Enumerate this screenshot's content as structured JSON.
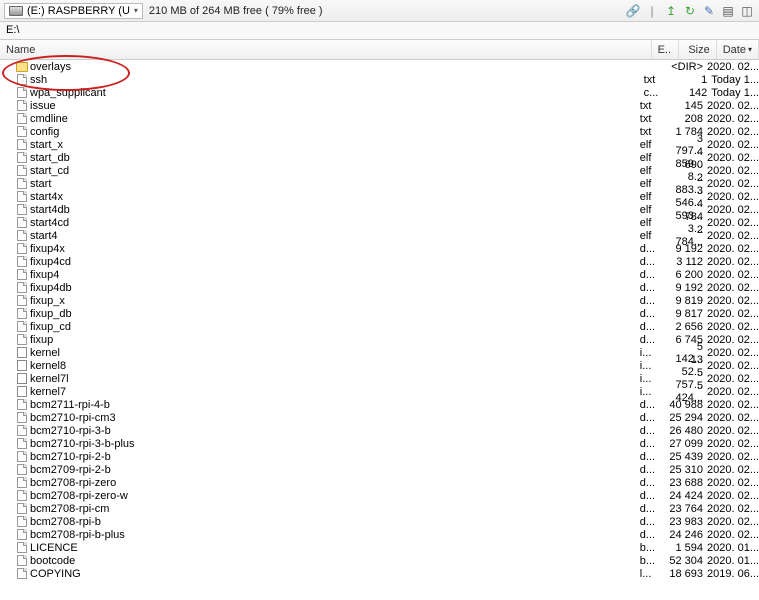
{
  "toolbar": {
    "drive_label": "(E:) RASPBERRY (U",
    "free_space": "210 MB of 264 MB free ( 79% free )"
  },
  "path": "E:\\",
  "headers": {
    "name": "Name",
    "ext": "E..",
    "size": "Size",
    "date": "Date"
  },
  "files": [
    {
      "icon": "folder",
      "name": "overlays",
      "ext": "",
      "size": "<DIR>",
      "date": "2020. 02..."
    },
    {
      "icon": "file",
      "name": "ssh",
      "ext": "txt",
      "size": "1",
      "date": "Today 1..."
    },
    {
      "icon": "file",
      "name": "wpa_supplicant",
      "ext": "c...",
      "size": "142",
      "date": "Today 1..."
    },
    {
      "icon": "file",
      "name": "issue",
      "ext": "txt",
      "size": "145",
      "date": "2020. 02..."
    },
    {
      "icon": "file",
      "name": "cmdline",
      "ext": "txt",
      "size": "208",
      "date": "2020. 02..."
    },
    {
      "icon": "file",
      "name": "config",
      "ext": "txt",
      "size": "1 784",
      "date": "2020. 02..."
    },
    {
      "icon": "file",
      "name": "start_x",
      "ext": "elf",
      "size": "3 797...",
      "date": "2020. 02..."
    },
    {
      "icon": "file",
      "name": "start_db",
      "ext": "elf",
      "size": "4 859...",
      "date": "2020. 02..."
    },
    {
      "icon": "file",
      "name": "start_cd",
      "ext": "elf",
      "size": "690 8...",
      "date": "2020. 02..."
    },
    {
      "icon": "file",
      "name": "start",
      "ext": "elf",
      "size": "2 883...",
      "date": "2020. 02..."
    },
    {
      "icon": "file",
      "name": "start4x",
      "ext": "elf",
      "size": "3 546...",
      "date": "2020. 02..."
    },
    {
      "icon": "file",
      "name": "start4db",
      "ext": "elf",
      "size": "4 593...",
      "date": "2020. 02..."
    },
    {
      "icon": "file",
      "name": "start4cd",
      "ext": "elf",
      "size": "784 3...",
      "date": "2020. 02..."
    },
    {
      "icon": "file",
      "name": "start4",
      "ext": "elf",
      "size": "2 784...",
      "date": "2020. 02..."
    },
    {
      "icon": "file",
      "name": "fixup4x",
      "ext": "d...",
      "size": "9 192",
      "date": "2020. 02..."
    },
    {
      "icon": "file",
      "name": "fixup4cd",
      "ext": "d...",
      "size": "3 112",
      "date": "2020. 02..."
    },
    {
      "icon": "file",
      "name": "fixup4",
      "ext": "d...",
      "size": "6 200",
      "date": "2020. 02..."
    },
    {
      "icon": "file",
      "name": "fixup4db",
      "ext": "d...",
      "size": "9 192",
      "date": "2020. 02..."
    },
    {
      "icon": "file",
      "name": "fixup_x",
      "ext": "d...",
      "size": "9 819",
      "date": "2020. 02..."
    },
    {
      "icon": "file",
      "name": "fixup_db",
      "ext": "d...",
      "size": "9 817",
      "date": "2020. 02..."
    },
    {
      "icon": "file",
      "name": "fixup_cd",
      "ext": "d...",
      "size": "2 656",
      "date": "2020. 02..."
    },
    {
      "icon": "file",
      "name": "fixup",
      "ext": "d...",
      "size": "6 745",
      "date": "2020. 02..."
    },
    {
      "icon": "bin",
      "name": "kernel",
      "ext": "i...",
      "size": "5 142...",
      "date": "2020. 02..."
    },
    {
      "icon": "bin",
      "name": "kernel8",
      "ext": "i...",
      "size": "13 52...",
      "date": "2020. 02..."
    },
    {
      "icon": "bin",
      "name": "kernel7l",
      "ext": "i...",
      "size": "5 757...",
      "date": "2020. 02..."
    },
    {
      "icon": "bin",
      "name": "kernel7",
      "ext": "i...",
      "size": "5 424...",
      "date": "2020. 02..."
    },
    {
      "icon": "file",
      "name": "bcm2711-rpi-4-b",
      "ext": "d...",
      "size": "40 988",
      "date": "2020. 02..."
    },
    {
      "icon": "file",
      "name": "bcm2710-rpi-cm3",
      "ext": "d...",
      "size": "25 294",
      "date": "2020. 02..."
    },
    {
      "icon": "file",
      "name": "bcm2710-rpi-3-b",
      "ext": "d...",
      "size": "26 480",
      "date": "2020. 02..."
    },
    {
      "icon": "file",
      "name": "bcm2710-rpi-3-b-plus",
      "ext": "d...",
      "size": "27 099",
      "date": "2020. 02..."
    },
    {
      "icon": "file",
      "name": "bcm2710-rpi-2-b",
      "ext": "d...",
      "size": "25 439",
      "date": "2020. 02..."
    },
    {
      "icon": "file",
      "name": "bcm2709-rpi-2-b",
      "ext": "d...",
      "size": "25 310",
      "date": "2020. 02..."
    },
    {
      "icon": "file",
      "name": "bcm2708-rpi-zero",
      "ext": "d...",
      "size": "23 688",
      "date": "2020. 02..."
    },
    {
      "icon": "file",
      "name": "bcm2708-rpi-zero-w",
      "ext": "d...",
      "size": "24 424",
      "date": "2020. 02..."
    },
    {
      "icon": "file",
      "name": "bcm2708-rpi-cm",
      "ext": "d...",
      "size": "23 764",
      "date": "2020. 02..."
    },
    {
      "icon": "file",
      "name": "bcm2708-rpi-b",
      "ext": "d...",
      "size": "23 983",
      "date": "2020. 02..."
    },
    {
      "icon": "file",
      "name": "bcm2708-rpi-b-plus",
      "ext": "d...",
      "size": "24 246",
      "date": "2020. 02..."
    },
    {
      "icon": "file",
      "name": "LICENCE",
      "ext": "b...",
      "size": "1 594",
      "date": "2020. 01..."
    },
    {
      "icon": "file",
      "name": "bootcode",
      "ext": "b...",
      "size": "52 304",
      "date": "2020. 01..."
    },
    {
      "icon": "file",
      "name": "COPYING",
      "ext": "l...",
      "size": "18 693",
      "date": "2019. 06..."
    }
  ]
}
